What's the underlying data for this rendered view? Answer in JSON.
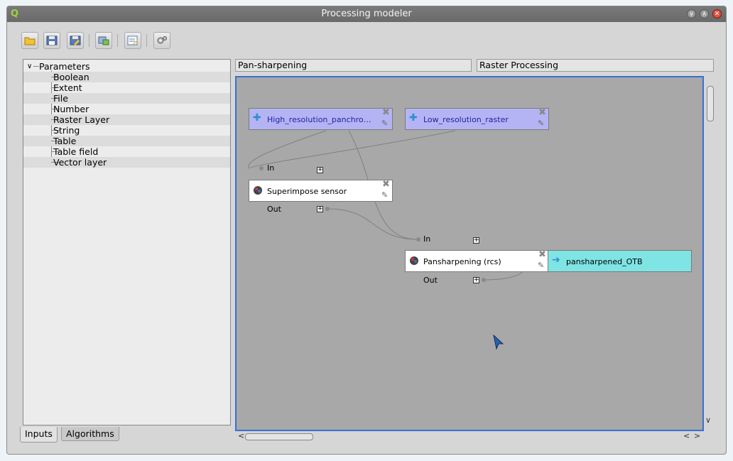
{
  "window": {
    "title": "Processing modeler",
    "app_icon": "qgis-icon"
  },
  "toolbar": {
    "buttons": [
      {
        "name": "open-model-button",
        "icon": "folder-open-icon"
      },
      {
        "name": "save-model-button",
        "icon": "floppy-icon"
      },
      {
        "name": "save-as-button",
        "icon": "floppy-edit-icon"
      },
      {
        "name": "export-image-button",
        "icon": "export-image-icon"
      },
      {
        "name": "edit-help-button",
        "icon": "edit-help-icon"
      },
      {
        "name": "run-model-button",
        "icon": "gears-icon"
      }
    ]
  },
  "left_panel": {
    "root_label": "Parameters",
    "items": [
      "Boolean",
      "Extent",
      "File",
      "Number",
      "Raster Layer",
      "String",
      "Table",
      "Table field",
      "Vector layer"
    ],
    "tabs": [
      "Inputs",
      "Algorithms"
    ],
    "active_tab": "Inputs"
  },
  "model": {
    "name": "Pan-sharpening",
    "group": "Raster Processing"
  },
  "canvas": {
    "nodes": {
      "param1": {
        "label": "High_resolution_panchro…",
        "icon": "plus-icon"
      },
      "param2": {
        "label": "Low_resolution_raster",
        "icon": "plus-icon"
      },
      "alg1": {
        "label": "Superimpose sensor",
        "icon": "otb-icon",
        "in_label": "In",
        "out_label": "Out"
      },
      "alg2": {
        "label": "Pansharpening (rcs)",
        "icon": "otb-icon",
        "in_label": "In",
        "out_label": "Out"
      },
      "output": {
        "label": "pansharpened_OTB",
        "icon": "arrow-right-icon"
      }
    }
  },
  "colors": {
    "accent": "#3a6fd1",
    "parameter_node": "#b4b4f5",
    "output_node": "#7fe4e4",
    "canvas_bg": "#a8a8a8"
  }
}
